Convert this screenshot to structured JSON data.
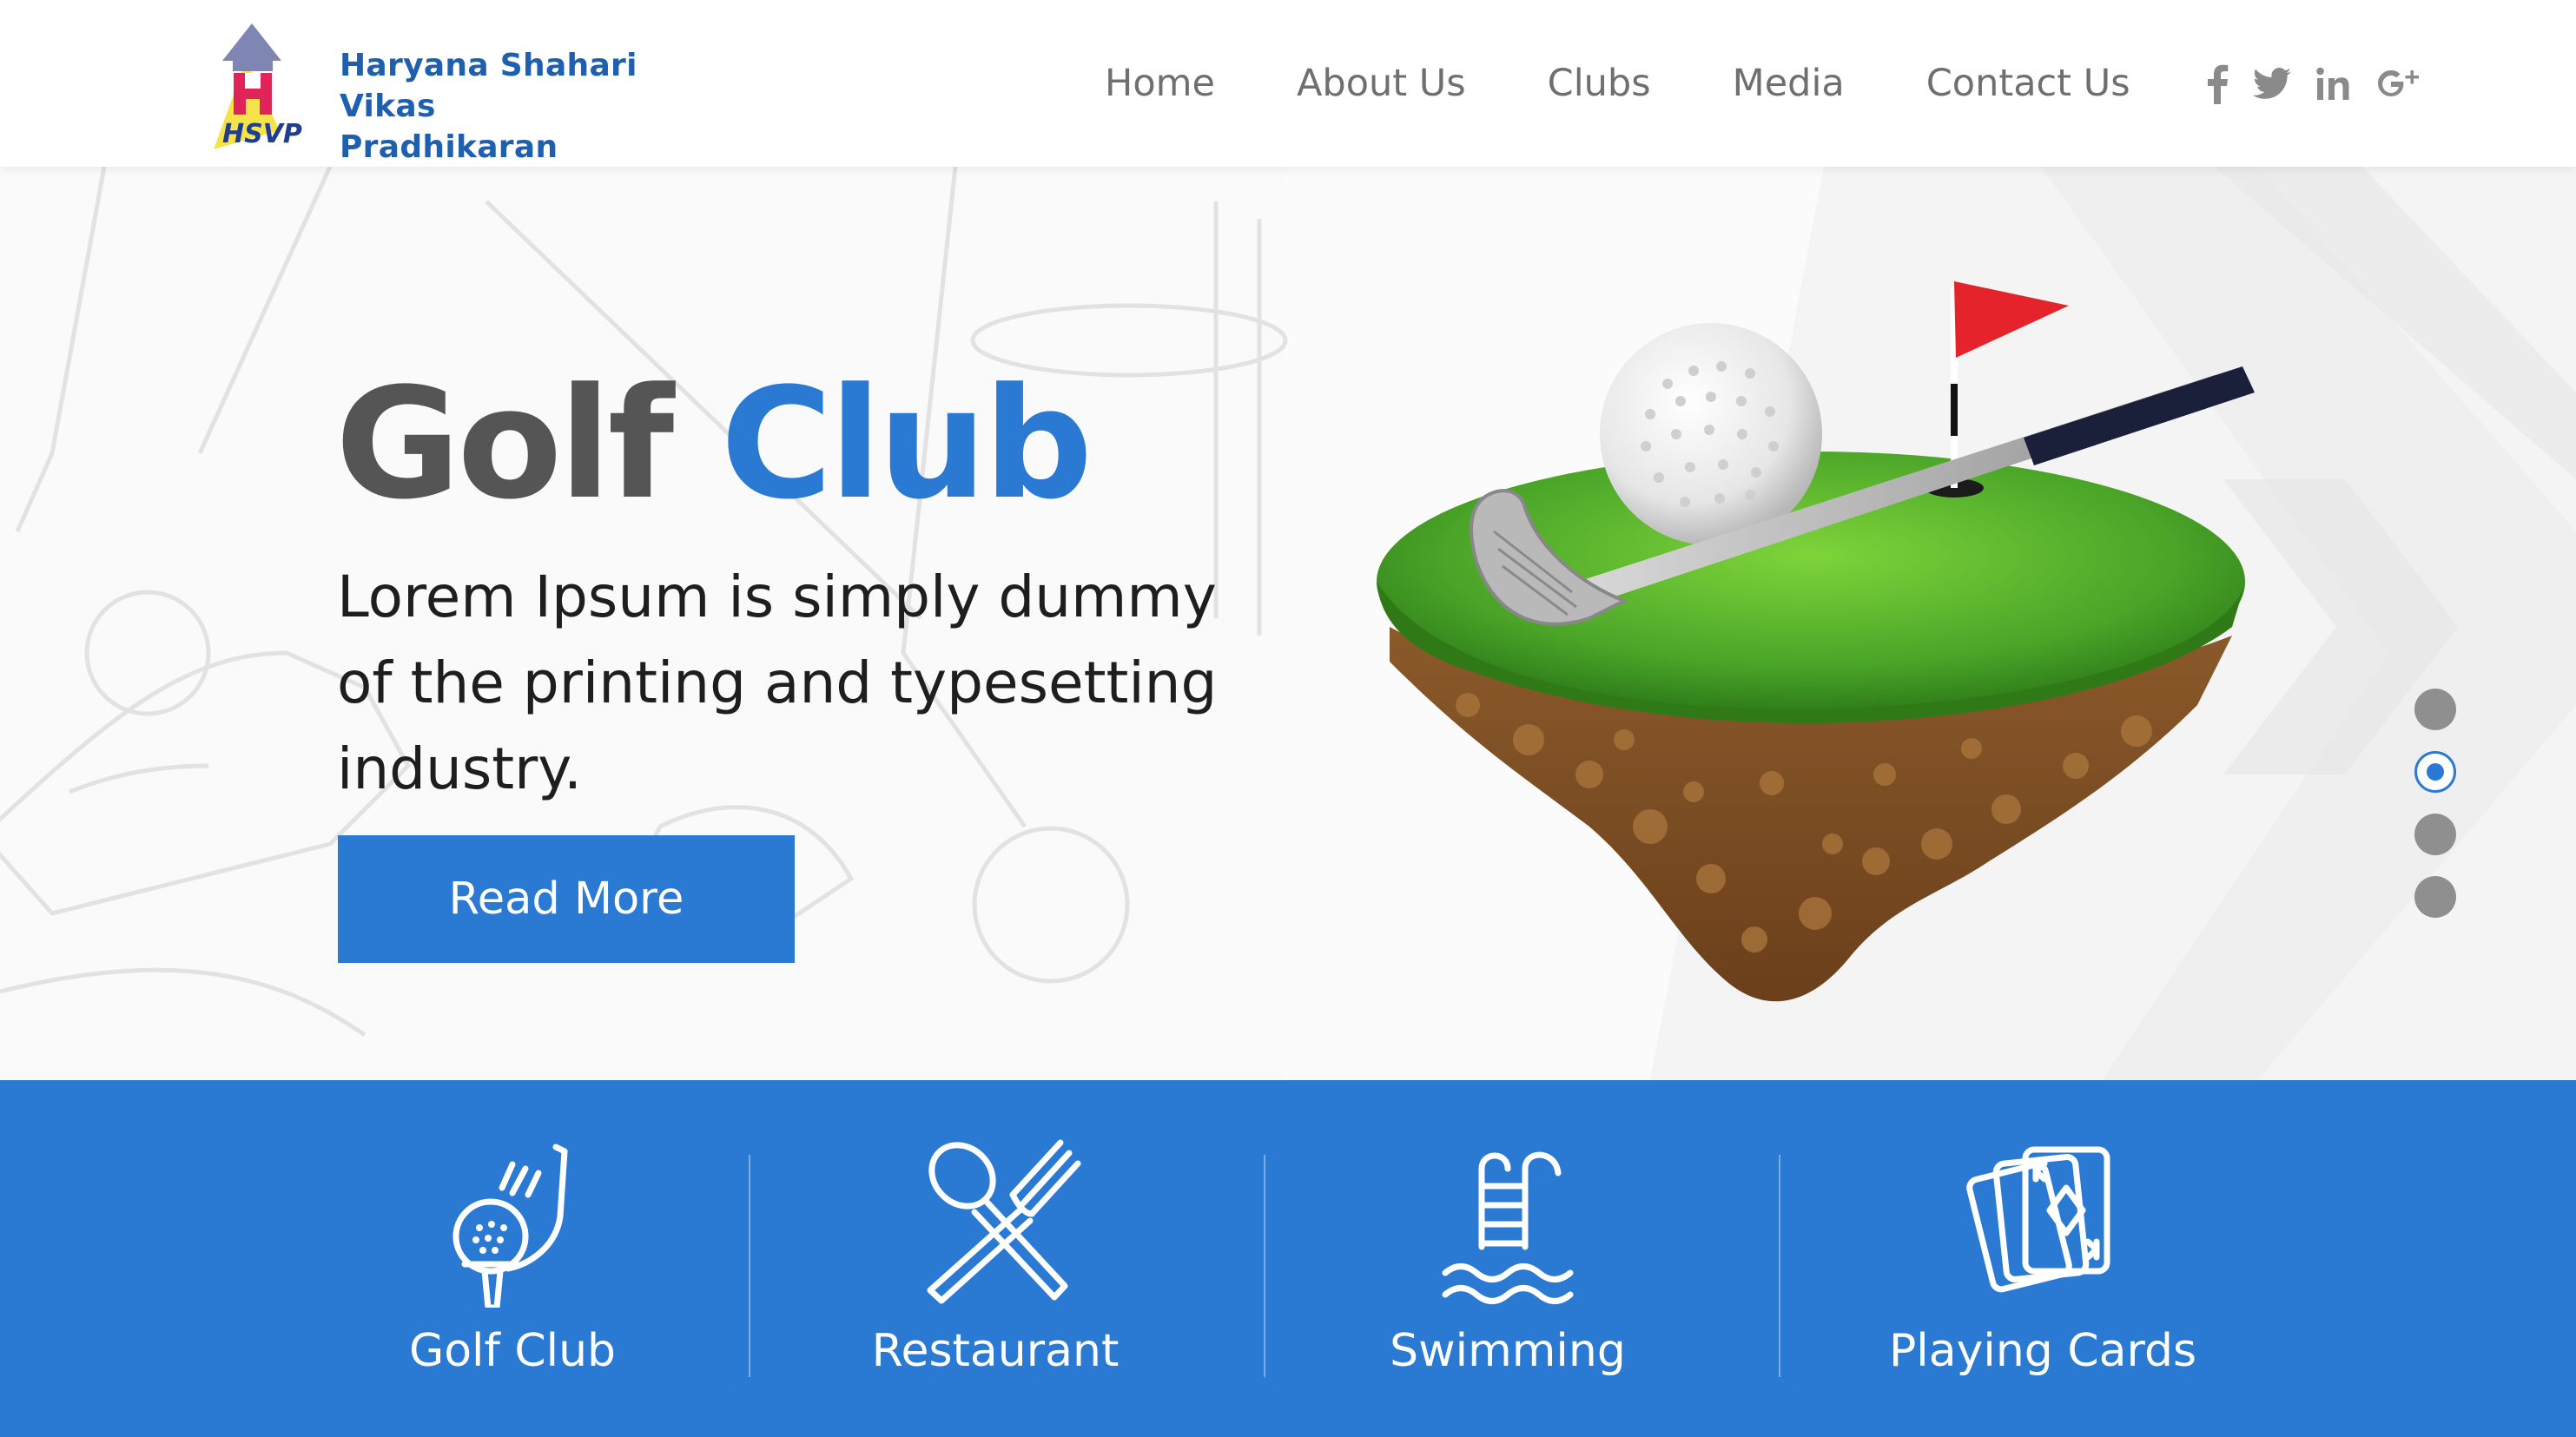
{
  "header": {
    "logo": {
      "abbr": "HSVP",
      "line1": "Haryana Shahari",
      "line2": "Vikas Pradhikaran"
    },
    "nav": [
      {
        "label": "Home"
      },
      {
        "label": "About Us"
      },
      {
        "label": "Clubs"
      },
      {
        "label": "Media"
      },
      {
        "label": "Contact Us"
      }
    ],
    "social": [
      "facebook-icon",
      "twitter-icon",
      "linkedin-icon",
      "google-plus-icon"
    ]
  },
  "hero": {
    "title_part1": "Golf",
    "title_part2": "Club",
    "description": "Lorem Ipsum is simply dummy of the printing and typesetting industry.",
    "button_label": "Read More",
    "slider_dots": 4,
    "active_dot": 2
  },
  "features": [
    {
      "label": "Golf Club",
      "icon": "golf-club-icon"
    },
    {
      "label": "Restaurant",
      "icon": "restaurant-icon"
    },
    {
      "label": "Swimming",
      "icon": "swimming-pool-icon"
    },
    {
      "label": "Playing Cards",
      "icon": "playing-cards-icon"
    }
  ],
  "colors": {
    "accent": "#2a7ad3",
    "nav_text": "#6f6f6f",
    "title_gray": "#555555",
    "logo_blue": "#1f5fb0"
  }
}
